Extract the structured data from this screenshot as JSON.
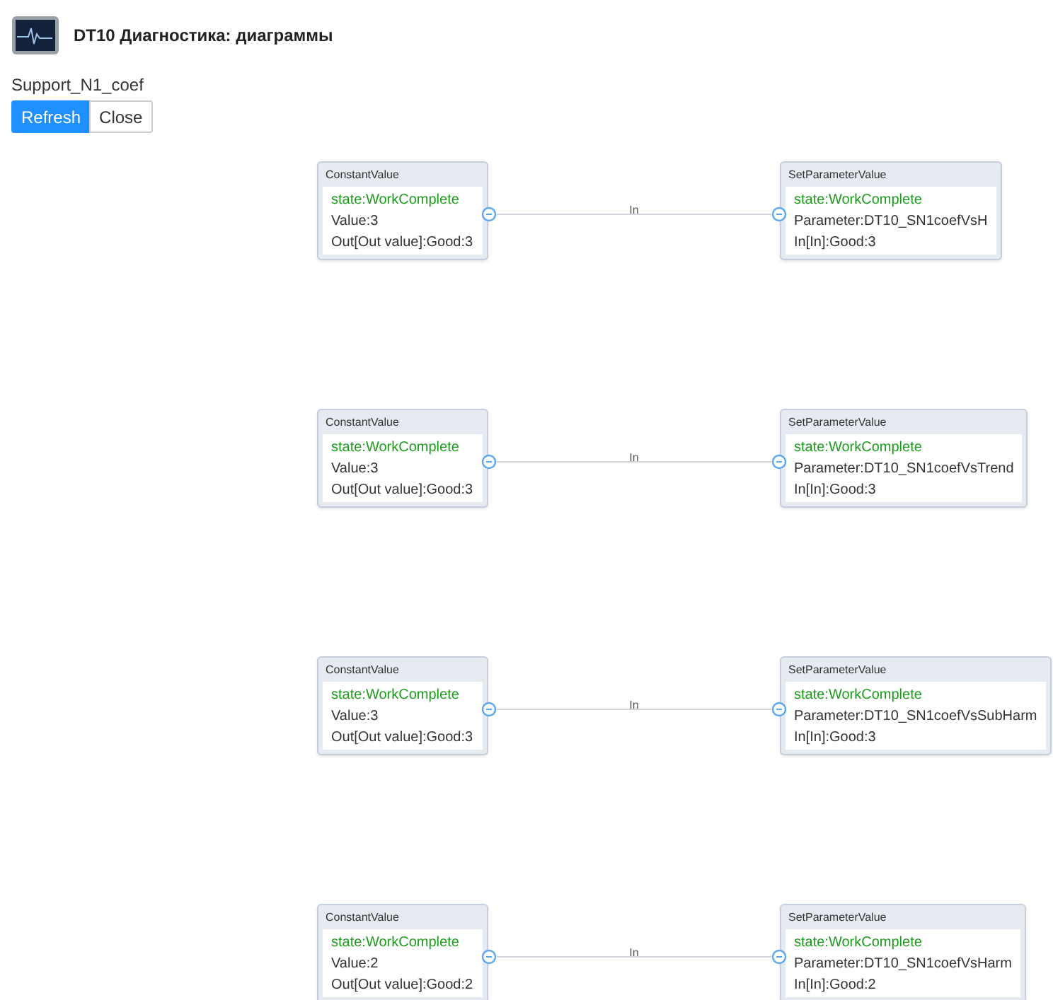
{
  "header": {
    "title": "DT10 Диагностика: диаграммы"
  },
  "subtitle": "Support_N1_coef",
  "buttons": [
    {
      "label": "Refresh",
      "kind": "primary"
    },
    {
      "label": "Close",
      "kind": "default"
    }
  ],
  "flows": [
    {
      "source": {
        "type": "ConstantValue",
        "state": "state:WorkComplete",
        "lines": [
          "Value:3",
          "Out[Out value]:Good:3"
        ]
      },
      "link": {
        "label": "In"
      },
      "target": {
        "type": "SetParameterValue",
        "state": "state:WorkComplete",
        "lines": [
          "Parameter:DT10_SN1coefVsH",
          "In[In]:Good:3"
        ]
      }
    },
    {
      "source": {
        "type": "ConstantValue",
        "state": "state:WorkComplete",
        "lines": [
          "Value:3",
          "Out[Out value]:Good:3"
        ]
      },
      "link": {
        "label": "In"
      },
      "target": {
        "type": "SetParameterValue",
        "state": "state:WorkComplete",
        "lines": [
          "Parameter:DT10_SN1coefVsTrend",
          "In[In]:Good:3"
        ]
      }
    },
    {
      "source": {
        "type": "ConstantValue",
        "state": "state:WorkComplete",
        "lines": [
          "Value:3",
          "Out[Out value]:Good:3"
        ]
      },
      "link": {
        "label": "In"
      },
      "target": {
        "type": "SetParameterValue",
        "state": "state:WorkComplete",
        "lines": [
          "Parameter:DT10_SN1coefVsSubHarm",
          "In[In]:Good:3"
        ]
      }
    },
    {
      "source": {
        "type": "ConstantValue",
        "state": "state:WorkComplete",
        "lines": [
          "Value:2",
          "Out[Out value]:Good:2"
        ]
      },
      "link": {
        "label": "In"
      },
      "target": {
        "type": "SetParameterValue",
        "state": "state:WorkComplete",
        "lines": [
          "Parameter:DT10_SN1coefVsHarm",
          "In[In]:Good:2"
        ]
      }
    }
  ]
}
